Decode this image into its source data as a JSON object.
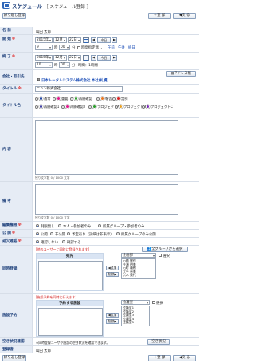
{
  "header": {
    "title": "スケジュール",
    "subtitle": "［ スケジュール登録 ］"
  },
  "toolbar": {
    "back_list": "繰り返し登録",
    "register": "登 録",
    "return": "戻 る"
  },
  "fields": {
    "name": {
      "label": "名 前",
      "value": "山田 太郎"
    },
    "start": {
      "label": "開 始",
      "year": "2015年",
      "month": "12月",
      "day": "22日",
      "today": "今日",
      "hour": "9",
      "hour_unit": "時",
      "min": "00",
      "min_unit": "分",
      "nospec": "時間指定無し",
      "am": "午前",
      "pm": "午後",
      "allday": "終日"
    },
    "end": {
      "label": "終 了",
      "year": "2015年",
      "month": "12月",
      "day": "22日",
      "today": "今日",
      "hour": "10",
      "hour_unit": "時",
      "min": "00",
      "min_unit": "分",
      "duration": "時間：1時間"
    },
    "company": {
      "label": "会社・取引先",
      "value": "日本トータルシステム株式会社 本社(札幌)",
      "addr_btn": "アドレス帳"
    },
    "title": {
      "label": "タイトル",
      "value": "ニュン株式会社"
    },
    "title_color": {
      "label": "タイトル色",
      "items": [
        {
          "name": "通常",
          "color": "#1a3f9e"
        },
        {
          "name": "重要",
          "color": "#e0198c"
        },
        {
          "name": "再開確認",
          "color": "#2b9c2b"
        },
        {
          "name": "報告",
          "color": "#e87722"
        },
        {
          "name": "定例",
          "color": "#d92525"
        },
        {
          "name": "再開確認1",
          "color": "#3a3a9e"
        },
        {
          "name": "再開確認2",
          "color": "#e0198c"
        },
        {
          "name": "プロジェクトA",
          "color": "#2b9c2b"
        },
        {
          "name": "プロジェクトB",
          "color": "#e8a022"
        },
        {
          "name": "プロジェクトC",
          "color": "#7a2bb8"
        }
      ]
    },
    "content": {
      "label": "内 容",
      "hint": "残り文字数 0 / 1000 文字"
    },
    "note": {
      "label": "備 考",
      "hint": "残り文字数 0 / 1000 文字"
    },
    "edit_perm": {
      "label": "編集権限",
      "options": [
        "制限無し",
        "本人・参加者のみ",
        "所属グループ・参加者のみ"
      ]
    },
    "public": {
      "label": "公 開",
      "options": [
        "公開",
        "非公開",
        "予定有り（詳細は非表示）",
        "所属グループのみ公開"
      ]
    },
    "reply": {
      "label": "返欠確認",
      "options": [
        "確認しない",
        "確認する"
      ]
    }
  },
  "participants": {
    "label": "同時登録",
    "note": "[他のユーザーに同時に登録されます]",
    "from_group_btn": "全グループから選択",
    "panel_title": "宛先",
    "dept": "企画部",
    "select_label": "選択",
    "add": "追加",
    "remove": "削除",
    "users": [
      "石橋 健也",
      "今瀬 明美",
      "石町 義樹",
      "大平 恵美",
      "六木 美代"
    ]
  },
  "facility": {
    "label": "施設予約",
    "note": "[施設予約を同時に行えます]",
    "panel_title": "予約する施設",
    "group": "会議室",
    "select_label": "選択",
    "add": "追加",
    "remove": "削除",
    "items": [
      "会議室1",
      "会議室2",
      "会議室3",
      "会議室4",
      "会議室5"
    ]
  },
  "vacancy": {
    "label": "空き状況確認",
    "note": "※同時登録ユーザや施設の空き状況を確認できます。",
    "btn": "空き状況"
  },
  "registrant": {
    "label": "登録者",
    "value": "山田 太郎"
  },
  "footer": {
    "back_list": "繰り返し登録",
    "register": "登 録",
    "return": "戻 る"
  }
}
